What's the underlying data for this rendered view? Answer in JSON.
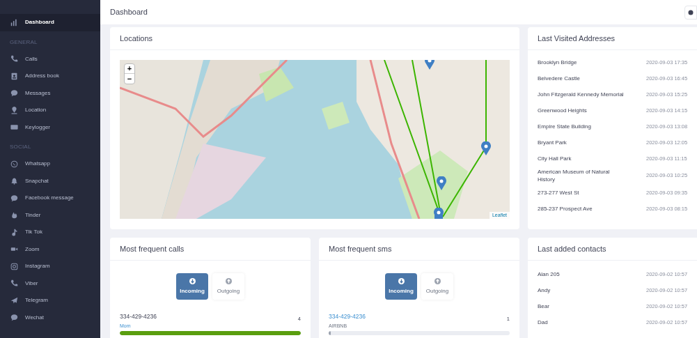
{
  "sidebar": {
    "items": [
      {
        "kind": "item",
        "label": "Dashboard",
        "selected": true
      },
      {
        "kind": "heading",
        "label": "GENERAL"
      },
      {
        "kind": "item",
        "label": "Calls",
        "selected": false
      },
      {
        "kind": "item",
        "label": "Address book",
        "selected": false
      },
      {
        "kind": "item",
        "label": "Messages",
        "selected": false
      },
      {
        "kind": "item",
        "label": "Location",
        "selected": false
      },
      {
        "kind": "item",
        "label": "Keylogger",
        "selected": false
      },
      {
        "kind": "heading",
        "label": "SOCIAL"
      },
      {
        "kind": "item",
        "label": "Whatsapp",
        "selected": false
      },
      {
        "kind": "item",
        "label": "Snapchat",
        "selected": false
      },
      {
        "kind": "item",
        "label": "Facebook message",
        "selected": false
      },
      {
        "kind": "item",
        "label": "Tinder",
        "selected": false
      },
      {
        "kind": "item",
        "label": "Tik Tok",
        "selected": false
      },
      {
        "kind": "item",
        "label": "Zoom",
        "selected": false
      },
      {
        "kind": "item",
        "label": "Instagram",
        "selected": false
      },
      {
        "kind": "item",
        "label": "Viber",
        "selected": false
      },
      {
        "kind": "item",
        "label": "Telegram",
        "selected": false
      },
      {
        "kind": "item",
        "label": "Wechat",
        "selected": false
      }
    ]
  },
  "header": {
    "title": "Dashboard"
  },
  "locations": {
    "title": "Locations",
    "zoom_in": "+",
    "zoom_out": "−",
    "attribution": "Leaflet"
  },
  "last_visited": {
    "title": "Last Visited Addresses",
    "rows": [
      {
        "place": "Brooklyn Bridge",
        "time": "2020-09-03 17:35"
      },
      {
        "place": "Belvedere Castle",
        "time": "2020-09-03 16:45"
      },
      {
        "place": "John Fitzgerald Kennedy Memorial",
        "time": "2020-09-03 15:25"
      },
      {
        "place": "Greenwood Heights",
        "time": "2020-09-03 14:15"
      },
      {
        "place": "Empire State Building",
        "time": "2020-09-03 13:08"
      },
      {
        "place": "Bryant Park",
        "time": "2020-09-03 12:05"
      },
      {
        "place": "City Hall Park",
        "time": "2020-09-03 11:15"
      },
      {
        "place": "American Museum of Natural History",
        "time": "2020-09-03 10:25"
      },
      {
        "place": "273-277 West St",
        "time": "2020-09-03 09:35"
      },
      {
        "place": "285-237 Prospect Ave",
        "time": "2020-09-03 08:15"
      }
    ]
  },
  "panels": [
    {
      "title": "Most frequent calls",
      "toggles": [
        {
          "label": "Incoming",
          "selected": true
        },
        {
          "label": "Outgoing",
          "selected": false
        }
      ],
      "entries": [
        {
          "number": "334-429-4236",
          "name": "Mom",
          "count": "4",
          "level": 1,
          "color": "#5a9e0f"
        }
      ]
    },
    {
      "title": "Most frequent sms",
      "toggles": [
        {
          "label": "Incoming",
          "selected": true
        },
        {
          "label": "Outgoing",
          "selected": false
        }
      ],
      "entries": [
        {
          "number": "334-429-4236",
          "name": "AIRBNB",
          "count": "1",
          "level": 0.01,
          "color": "#9ca3af"
        }
      ]
    }
  ],
  "last_contacts": {
    "title": "Last added contacts",
    "rows": [
      {
        "name": "Alan 205",
        "time": "2020-09-02 10:57"
      },
      {
        "name": "Andy",
        "time": "2020-09-02 10:57"
      },
      {
        "name": "Bear",
        "time": "2020-09-02 10:57"
      },
      {
        "name": "Dad",
        "time": "2020-09-02 10:57"
      }
    ]
  }
}
